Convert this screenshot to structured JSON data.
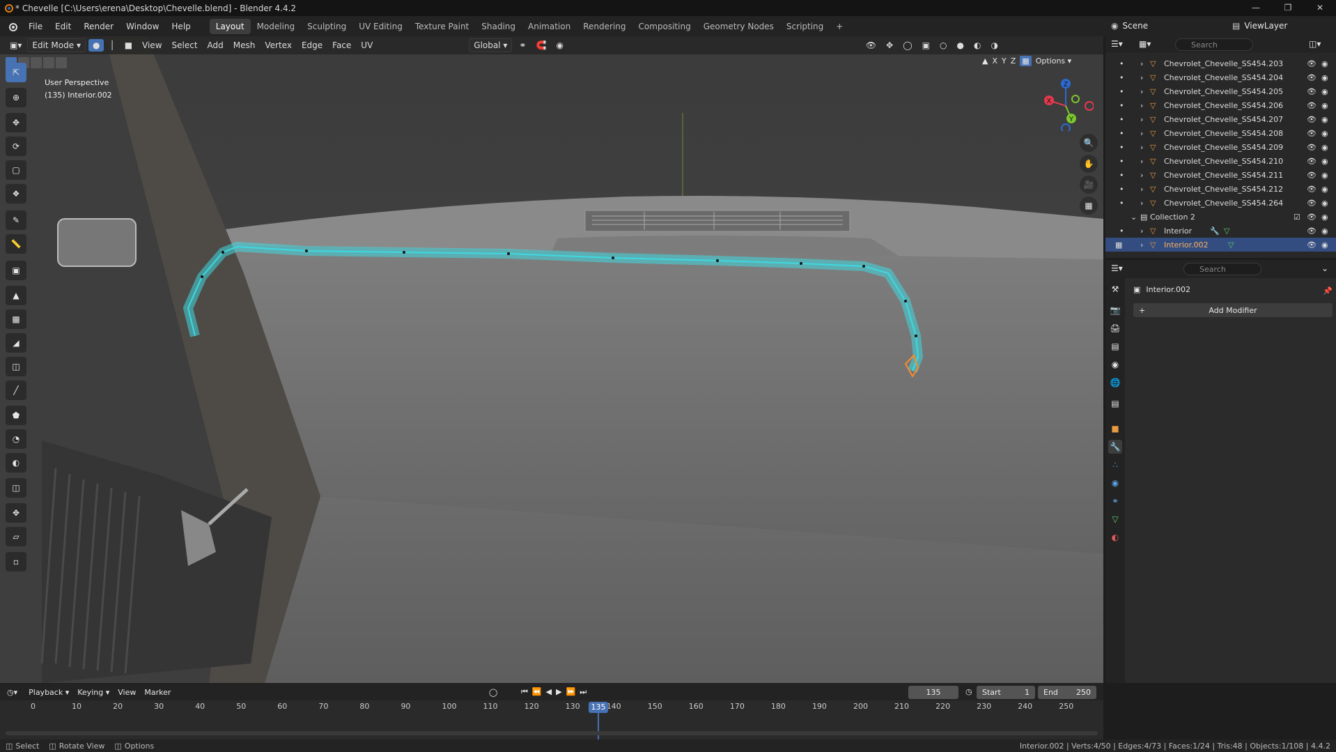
{
  "window": {
    "title": "* Chevelle [C:\\Users\\erena\\Desktop\\Chevelle.blend] - Blender 4.4.2"
  },
  "menu": [
    "File",
    "Edit",
    "Render",
    "Window",
    "Help"
  ],
  "workspaces": [
    "Layout",
    "Modeling",
    "Sculpting",
    "UV Editing",
    "Texture Paint",
    "Shading",
    "Animation",
    "Rendering",
    "Compositing",
    "Geometry Nodes",
    "Scripting"
  ],
  "active_workspace": "Layout",
  "scene": {
    "name": "Scene",
    "view_layer": "ViewLayer"
  },
  "viewport": {
    "mode": "Edit Mode",
    "menus": [
      "View",
      "Select",
      "Add",
      "Mesh",
      "Vertex",
      "Edge",
      "Face",
      "UV"
    ],
    "orientation": "Global",
    "info_line1": "User Perspective",
    "info_line2": "(135) Interior.002",
    "axis_labels": [
      "X",
      "Y",
      "Z"
    ],
    "options_label": "Options"
  },
  "outliner": {
    "search_placeholder": "Search",
    "items": [
      {
        "name": "Chevrolet_Chevelle_SS454.203"
      },
      {
        "name": "Chevrolet_Chevelle_SS454.204"
      },
      {
        "name": "Chevrolet_Chevelle_SS454.205"
      },
      {
        "name": "Chevrolet_Chevelle_SS454.206"
      },
      {
        "name": "Chevrolet_Chevelle_SS454.207"
      },
      {
        "name": "Chevrolet_Chevelle_SS454.208"
      },
      {
        "name": "Chevrolet_Chevelle_SS454.209"
      },
      {
        "name": "Chevrolet_Chevelle_SS454.210"
      },
      {
        "name": "Chevrolet_Chevelle_SS454.211"
      },
      {
        "name": "Chevrolet_Chevelle_SS454.212"
      },
      {
        "name": "Chevrolet_Chevelle_SS454.264"
      },
      {
        "name": "Collection 2"
      },
      {
        "name": "Interior"
      },
      {
        "name": "Interior.002"
      }
    ]
  },
  "properties": {
    "search_placeholder": "Search",
    "object_name": "Interior.002",
    "add_modifier": "Add Modifier"
  },
  "timeline": {
    "menus": [
      "Playback",
      "Keying",
      "View",
      "Marker"
    ],
    "current_frame": "135",
    "start_label": "Start",
    "start": "1",
    "end_label": "End",
    "end": "250",
    "ticks": [
      "0",
      "10",
      "20",
      "30",
      "40",
      "50",
      "60",
      "70",
      "80",
      "90",
      "100",
      "110",
      "120",
      "130",
      "140",
      "150",
      "160",
      "170",
      "180",
      "190",
      "200",
      "210",
      "220",
      "230",
      "240",
      "250"
    ]
  },
  "statusbar": {
    "left": [
      "Select",
      "Rotate View",
      "Options"
    ],
    "right": "Interior.002 | Verts:4/50 | Edges:4/73 | Faces:1/24 | Tris:48 | Objects:1/108 | 4.4.2"
  },
  "colors": {
    "accent": "#4772b3",
    "wire": "#3fd8e0",
    "selected_vertex": "#ff8a2a"
  }
}
